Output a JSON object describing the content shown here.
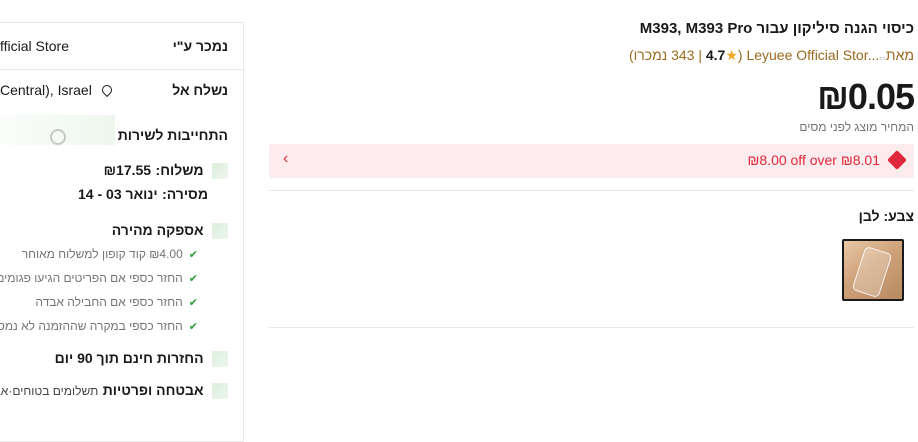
{
  "product": {
    "title": "כיסוי הגנה סיליקון עבור M393, M393 Pro",
    "store_prefix": "מאת",
    "store_name": "Leyuee Official Stor...",
    "rating": "4.7",
    "sold_count": "343",
    "sold_label": "נמכרו",
    "price": "₪0.05",
    "tax_note": "המחיר מוצג לפני מסים",
    "coupon_text": "₪8.00 off over ₪8.01",
    "color_label": "צבע: לבן"
  },
  "sidebar": {
    "sold_by_label": "נמכר ע\"י",
    "sold_by_value": "fficial Store",
    "ships_from_label": "נשלח אל",
    "ships_from_value": "Central), Israel",
    "service_title": "התחייבות לשירות",
    "shipping_label": "משלוח:",
    "shipping_value": "₪17.55",
    "delivery_label": "מסירה:",
    "delivery_value": "ינואר 03 - 14",
    "fast_title": "אספקה מהירה",
    "fast_items": [
      "₪4.00 קוד קופון למשלוח מאוחר",
      "החזר כספי אם הפריטים הגיעו פגומים",
      "החזר כספי אם החבילה אבדה",
      "החזר כספי במקרה שההזמנה לא נמסרה"
    ],
    "returns_title": "החזרות חינם תוך 90 יום",
    "security_title": "אבטחה ופרטיות",
    "security_value": "תשלומים בטוחים·אבטחת"
  },
  "colors": {
    "accent": "#e0293a",
    "check": "#2e9f3c",
    "gold": "#f5a623"
  }
}
